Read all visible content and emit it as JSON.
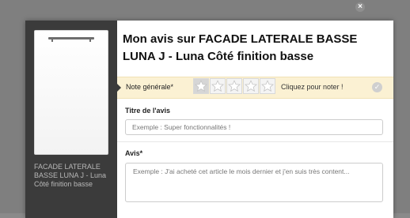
{
  "product": {
    "caption": "FACADE LATERALE BASSE LUNA J - Luna Côté finition basse"
  },
  "modal": {
    "title": "Mon avis sur FACADE LATERALE BASSE LUNA J - Luna Côté finition basse",
    "close_glyph": "×",
    "close_icon": "close-icon"
  },
  "rating": {
    "label": "Note générale*",
    "cta": "Cliquez pour noter !",
    "stars_total": 5,
    "stars_selected": 0,
    "check_glyph": "✓",
    "check_icon": "check-icon"
  },
  "review_title": {
    "label": "Titre de l'avis",
    "placeholder": "Exemple : Super fonctionnalités !",
    "value": ""
  },
  "review_body": {
    "label": "Avis*",
    "placeholder": "Exemple : J'ai acheté cet article le mois dernier et j'en suis très content...",
    "value": ""
  },
  "colors": {
    "sidebar": "#3b3b3b",
    "rating_bar": "#fbf1d3",
    "backdrop": "#7f7f7f"
  }
}
